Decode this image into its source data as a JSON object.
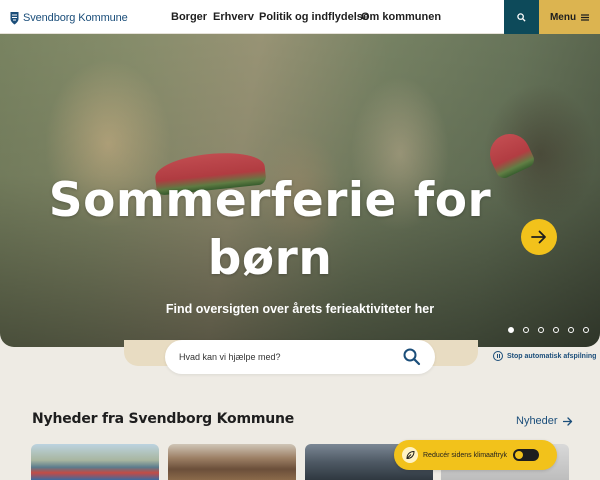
{
  "header": {
    "logo_text": "Svendborg Kommune",
    "nav": [
      "Borger",
      "Erhverv",
      "Politik og indflydelse",
      "Om kommunen"
    ],
    "menu_label": "Menu",
    "search_icon": "search-icon",
    "menu_icon": "hamburger-icon"
  },
  "hero": {
    "title": "Sommerferie for børn",
    "subtitle": "Find oversigten over årets ferieaktiviteter her",
    "arrow_icon": "arrow-right-icon",
    "slide_count": 6,
    "active_slide": 1
  },
  "search": {
    "placeholder": "Hvad kan vi hjælpe med?",
    "value": ""
  },
  "carousel": {
    "stop_label": "Stop automatisk afspilning"
  },
  "news": {
    "heading": "Nyheder fra Svendborg Kommune",
    "link_label": "Nyheder"
  },
  "climate": {
    "label": "Reducér sidens klimaaftryk",
    "toggle_on": false
  },
  "colors": {
    "brand_blue": "#1b4e7a",
    "search_teal": "#0d4a5a",
    "menu_gold": "#dcb450",
    "accent_yellow": "#f2c21b",
    "page_bg": "#eeebe4"
  }
}
